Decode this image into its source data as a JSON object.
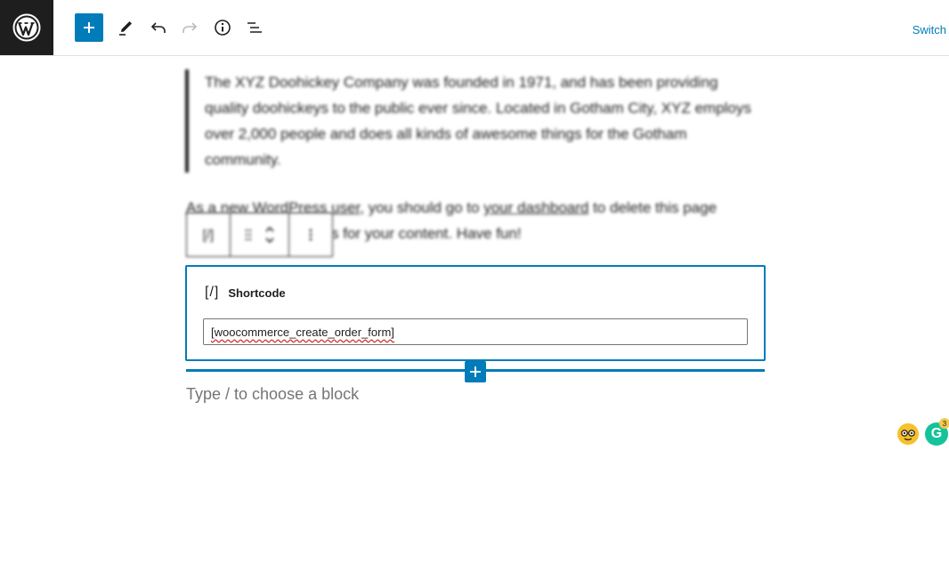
{
  "toolbar": {
    "switch_label": "Switch",
    "buttons": [
      "add-block",
      "tools",
      "undo",
      "redo",
      "details",
      "list-view"
    ]
  },
  "content": {
    "quote_text": "The XYZ Doohickey Company was founded in 1971, and has been providing quality doohickeys to the public ever since. Located in Gotham City, XYZ employs over 2,000 people and does all kinds of awesome things for the Gotham community.",
    "para_part1": "As a new WordPress user",
    "para_part2": ", you should go to ",
    "para_link": "your dashboard",
    "para_part3": " to delete this page",
    "para_line2": "s for your content. Have fun!"
  },
  "ghost_toolbar": {
    "shortcode_glyph": "[/]"
  },
  "shortcode_block": {
    "label": "Shortcode",
    "icon_glyph": "[/]",
    "value": "[woocommerce_create_order_form]"
  },
  "editor": {
    "placeholder": "Type / to choose a block"
  },
  "grammarly": {
    "letter": "G",
    "badge_count": "3"
  },
  "colors": {
    "accent": "#007cba",
    "logo_bg": "#1e1e1e",
    "grammarly": "#15c39a"
  }
}
